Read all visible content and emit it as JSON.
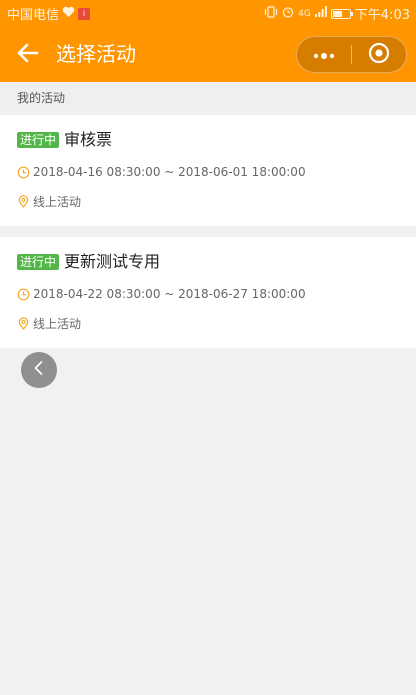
{
  "statusbar": {
    "carrier": "中国电信",
    "app_badge": "i",
    "network": "4G",
    "time": "下午4:03",
    "battery_level": 0.45
  },
  "navbar": {
    "title": "选择活动",
    "back_icon": "arrow-left-icon",
    "more_icon": "more-dots-icon",
    "close_icon": "target-circle-icon"
  },
  "section": {
    "label": "我的活动"
  },
  "activities": [
    {
      "status": "进行中",
      "title": "审核票",
      "time_range": "2018-04-16 08:30:00 ~ 2018-06-01 18:00:00",
      "location": "线上活动"
    },
    {
      "status": "进行中",
      "title": "更新测试专用",
      "time_range": "2018-04-22 08:30:00 ~ 2018-06-27 18:00:00",
      "location": "线上活动"
    }
  ],
  "colors": {
    "brand": "#ff9600",
    "badge": "#52b748",
    "icon": "#f5a623"
  },
  "floating": {
    "back_icon": "chevron-left-icon"
  }
}
